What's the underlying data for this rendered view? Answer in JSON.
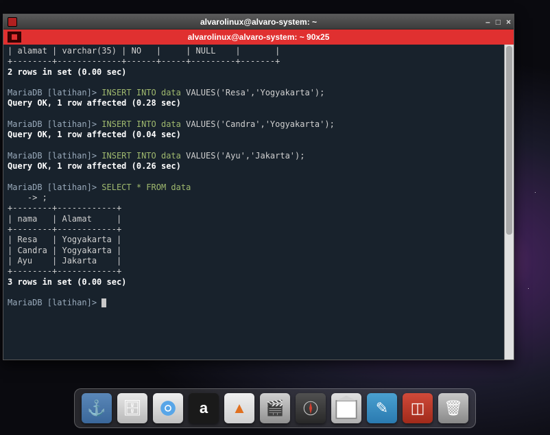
{
  "window": {
    "title": "alvarolinux@alvaro-system: ~",
    "min": "–",
    "max": "□",
    "close": "×"
  },
  "tab": {
    "title": "alvarolinux@alvaro-system: ~ 90x25"
  },
  "terminal": {
    "describe_line": "| alamat | varchar(35) | NO   |     | NULL    |       |",
    "describe_border": "+--------+-------------+------+-----+---------+-------+",
    "rows2": "2 rows in set (0.00 sec)",
    "prompt": "MariaDB [latihan]>",
    "cont": "    -> ",
    "insert1_pre": " INSERT INTO data ",
    "insert1_suf": "VALUES('Resa','Yogyakarta');",
    "ok1": "Query OK, 1 row affected (0.28 sec)",
    "insert2_pre": " INSERT INTO data ",
    "insert2_suf": "VALUES('Candra','Yogyakarta');",
    "ok2": "Query OK, 1 row affected (0.04 sec)",
    "insert3_pre": " INSERT INTO data ",
    "insert3_suf": "VALUES('Ayu','Jakarta');",
    "ok3": "Query OK, 1 row affected (0.26 sec)",
    "select": " SELECT * FROM data",
    "semi": ";",
    "table_border": "+--------+------------+",
    "table_header": "| nama   | Alamat     |",
    "row1": "| Resa   | Yogyakarta |",
    "row2": "| Candra | Yogyakarta |",
    "row3": "| Ayu    | Jakarta    |",
    "rows3": "3 rows in set (0.00 sec)",
    "space": " "
  },
  "dock": {
    "anchor": "⚓",
    "files": "🗄",
    "app": "a",
    "vlc": "▲",
    "video": "🎬",
    "write": "✎",
    "red": "◫",
    "trash": "🗑"
  }
}
